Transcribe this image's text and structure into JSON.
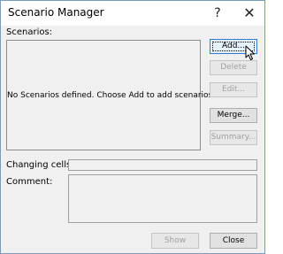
{
  "window": {
    "title": "Scenario Manager",
    "help_glyph": "?",
    "close_glyph": "✕"
  },
  "scenarios": {
    "label": "Scenarios:",
    "empty_message": "No Scenarios defined. Choose Add to add scenarios."
  },
  "buttons": {
    "add": "Add...",
    "delete": "Delete",
    "edit": "Edit...",
    "merge": "Merge...",
    "summary": "Summary...",
    "show": "Show",
    "close": "Close"
  },
  "fields": {
    "changing_cells_label": "Changing cells:",
    "changing_cells_value": "",
    "comment_label": "Comment:",
    "comment_value": ""
  },
  "icons": {
    "cursor": "mouse-pointer-icon"
  }
}
